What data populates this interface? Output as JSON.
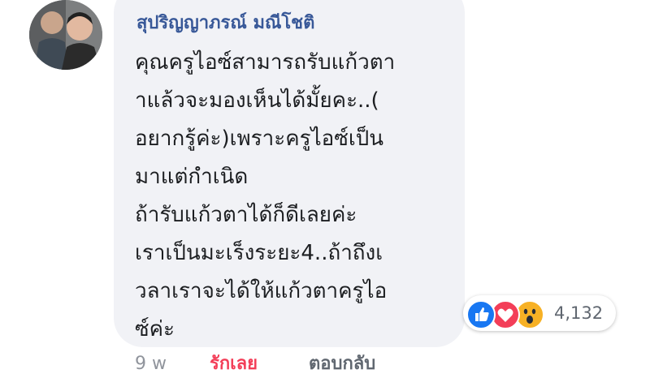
{
  "comment": {
    "author": "สุปริญญาภรณ์ มณีโชติ",
    "lines": [
      "คุณครูไอซ์สามารถรับแก้วตา",
      "าแล้วจะมองเห็นได้มั้ยคะ..(",
      "อยากรู้ค่ะ)เพราะครูไอซ์เป็น",
      "มาแต่กำเนิด",
      "ถ้ารับแก้วตาได้ก็ดีเลยค่ะ",
      "เราเป็นมะเร็งระยะ4..ถ้าถึงเ",
      "วลาเราจะได้ให้แก้วตาครูไอ",
      "ซ์ค่ะ"
    ],
    "reactions": {
      "icons": [
        "like-icon",
        "love-icon",
        "wow-icon"
      ],
      "count": "4,132",
      "colors": {
        "like": "#1877f2",
        "love": "#f33e58",
        "wow": "#f7b125"
      }
    },
    "time": "9 w",
    "like_label": "รักเลย",
    "reply_label": "ตอบกลับ"
  },
  "colors": {
    "author": "#385898",
    "bubble": "#f1f2f6",
    "text": "#1c1e21",
    "meta": "#90949c"
  }
}
